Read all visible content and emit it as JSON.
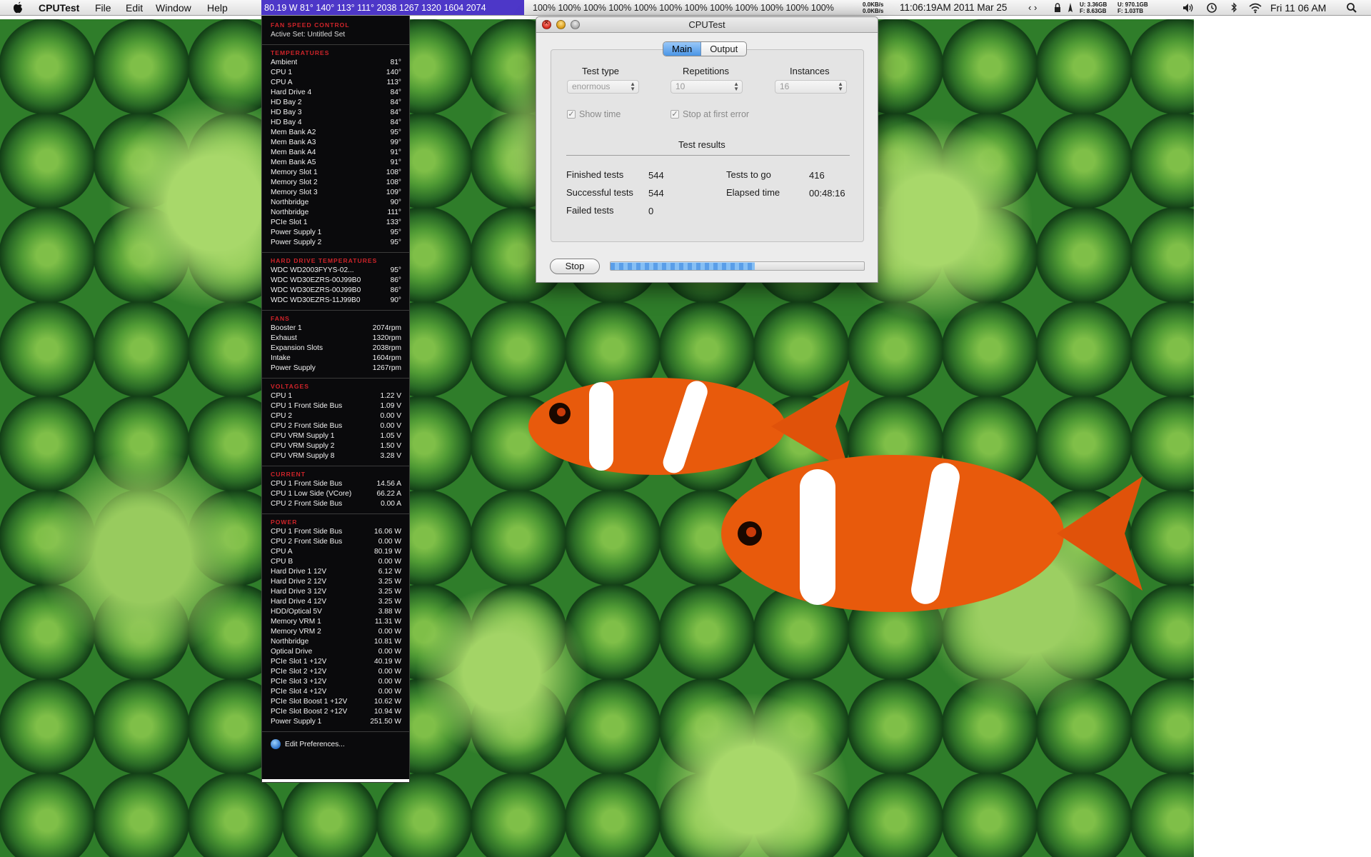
{
  "menubar": {
    "app_name": "CPUTest",
    "menus": [
      "File",
      "Edit",
      "Window",
      "Help"
    ],
    "sensor_readout": "80.19 W 81° 140° 113° 111° 2038 1267 1320 1604 2074",
    "cpu_usage": "100% 100% 100% 100% 100% 100% 100% 100% 100% 100% 100% 100%",
    "net_in": "0.0KB/s",
    "net_out": "0.0KB/s",
    "clock": "11:06:19AM 2011 Mar 25",
    "arrows": "‹ ›",
    "disk_u1": "U: 3.36GB",
    "disk_f1": "F: 8.63GB",
    "disk_u2": "U: 970.1GB",
    "disk_f2": "F: 1.03TB",
    "day_time": "Fri 11 06 AM"
  },
  "fan_panel": {
    "header_fan_speed": "FAN SPEED CONTROL",
    "active_set_label": "Active Set: Untitled Set",
    "sections": [
      {
        "title": "TEMPERATURES",
        "rows": [
          [
            "Ambient",
            "81°"
          ],
          [
            "CPU 1",
            "140°"
          ],
          [
            "CPU A",
            "113°"
          ],
          [
            "Hard Drive 4",
            "84°"
          ],
          [
            "HD Bay 2",
            "84°"
          ],
          [
            "HD Bay 3",
            "84°"
          ],
          [
            "HD Bay 4",
            "84°"
          ],
          [
            "Mem Bank A2",
            "95°"
          ],
          [
            "Mem Bank A3",
            "99°"
          ],
          [
            "Mem Bank A4",
            "91°"
          ],
          [
            "Mem Bank A5",
            "91°"
          ],
          [
            "Memory Slot 1",
            "108°"
          ],
          [
            "Memory Slot 2",
            "108°"
          ],
          [
            "Memory Slot 3",
            "109°"
          ],
          [
            "Northbridge",
            "90°"
          ],
          [
            "Northbridge",
            "111°"
          ],
          [
            "PCIe Slot 1",
            "133°"
          ],
          [
            "Power Supply 1",
            "95°"
          ],
          [
            "Power Supply 2",
            "95°"
          ]
        ]
      },
      {
        "title": "HARD DRIVE TEMPERATURES",
        "rows": [
          [
            "WDC WD2003FYYS-02...",
            "95°"
          ],
          [
            "WDC WD30EZRS-00J99B0",
            "86°"
          ],
          [
            "WDC WD30EZRS-00J99B0",
            "86°"
          ],
          [
            "WDC WD30EZRS-11J99B0",
            "90°"
          ]
        ]
      },
      {
        "title": "FANS",
        "rows": [
          [
            "Booster 1",
            "2074rpm"
          ],
          [
            "Exhaust",
            "1320rpm"
          ],
          [
            "Expansion Slots",
            "2038rpm"
          ],
          [
            "Intake",
            "1604rpm"
          ],
          [
            "Power Supply",
            "1267rpm"
          ]
        ]
      },
      {
        "title": "VOLTAGES",
        "rows": [
          [
            "CPU 1",
            "1.22 V"
          ],
          [
            "CPU 1 Front Side Bus",
            "1.09 V"
          ],
          [
            "CPU 2",
            "0.00 V"
          ],
          [
            "CPU 2 Front Side Bus",
            "0.00 V"
          ],
          [
            "CPU VRM Supply 1",
            "1.05 V"
          ],
          [
            "CPU VRM Supply 2",
            "1.50 V"
          ],
          [
            "CPU VRM Supply 8",
            "3.28 V"
          ]
        ]
      },
      {
        "title": "CURRENT",
        "rows": [
          [
            "CPU 1 Front Side Bus",
            "14.56 A"
          ],
          [
            "CPU 1 Low Side (VCore)",
            "66.22 A"
          ],
          [
            "CPU 2 Front Side Bus",
            "0.00 A"
          ]
        ]
      },
      {
        "title": "POWER",
        "rows": [
          [
            "CPU 1 Front Side Bus",
            "16.06 W"
          ],
          [
            "CPU 2 Front Side Bus",
            "0.00 W"
          ],
          [
            "CPU A",
            "80.19 W"
          ],
          [
            "CPU B",
            "0.00 W"
          ],
          [
            "Hard Drive 1 12V",
            "6.12 W"
          ],
          [
            "Hard Drive 2 12V",
            "3.25 W"
          ],
          [
            "Hard Drive 3 12V",
            "3.25 W"
          ],
          [
            "Hard Drive 4 12V",
            "3.25 W"
          ],
          [
            "HDD/Optical 5V",
            "3.88 W"
          ],
          [
            "Memory VRM 1",
            "11.31 W"
          ],
          [
            "Memory VRM 2",
            "0.00 W"
          ],
          [
            "Northbridge",
            "10.81 W"
          ],
          [
            "Optical Drive",
            "0.00 W"
          ],
          [
            "PCIe Slot 1 +12V",
            "40.19 W"
          ],
          [
            "PCIe Slot 2 +12V",
            "0.00 W"
          ],
          [
            "PCIe Slot 3 +12V",
            "0.00 W"
          ],
          [
            "PCIe Slot 4 +12V",
            "0.00 W"
          ],
          [
            "PCIe Slot Boost 1 +12V",
            "10.62 W"
          ],
          [
            "PCIe Slot Boost 2 +12V",
            "10.94 W"
          ],
          [
            "Power Supply 1",
            "251.50 W"
          ]
        ]
      }
    ],
    "edit_prefs": "Edit Preferences..."
  },
  "window": {
    "title": "CPUTest",
    "tabs": [
      "Main",
      "Output"
    ],
    "active_tab": "Main",
    "test_type_label": "Test type",
    "test_type_value": "enormous",
    "repetitions_label": "Repetitions",
    "repetitions_value": "10",
    "instances_label": "Instances",
    "instances_value": "16",
    "show_time_label": "Show time",
    "show_time_checked": true,
    "stop_first_error_label": "Stop at first error",
    "stop_first_error_checked": true,
    "results_title": "Test results",
    "finished_label": "Finished tests",
    "finished_value": "544",
    "togo_label": "Tests to go",
    "togo_value": "416",
    "successful_label": "Successful tests",
    "successful_value": "544",
    "elapsed_label": "Elapsed time",
    "elapsed_value": "00:48:16",
    "failed_label": "Failed tests",
    "failed_value": "0",
    "stop_button": "Stop",
    "progress_fraction": 0.57
  },
  "colors": {
    "menubar_sensor_bg": "#4d37c8",
    "panel_header": "#d0242a",
    "progress": "#5a9ee8"
  },
  "icons": [
    "apple-icon",
    "close-icon",
    "minimize-icon",
    "zoom-icon",
    "pen-icon",
    "lock-icon",
    "wifi-icon",
    "volume-icon",
    "time-machine-icon",
    "bluetooth-icon",
    "spotlight-icon",
    "preferences-icon"
  ]
}
